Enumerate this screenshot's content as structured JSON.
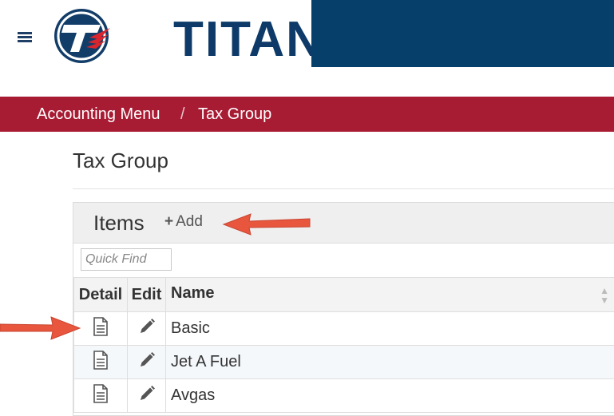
{
  "header": {
    "logo_text": "TITAN",
    "menu_icon": "hamburger-icon"
  },
  "breadcrumb": {
    "items": [
      "Accounting Menu",
      "Tax Group"
    ],
    "separator": "/"
  },
  "page": {
    "title": "Tax Group"
  },
  "panel": {
    "title": "Items",
    "add_label": "Add",
    "search": {
      "placeholder": "Quick Find",
      "value": ""
    }
  },
  "table": {
    "columns": [
      "Detail",
      "Edit",
      "Name"
    ],
    "rows": [
      {
        "name": "Basic"
      },
      {
        "name": "Jet A Fuel"
      },
      {
        "name": "Avgas"
      }
    ]
  },
  "colors": {
    "brand_navy": "#073f6b",
    "breadcrumb_red": "#a71b33",
    "annotation_arrow": "#e8563e"
  }
}
